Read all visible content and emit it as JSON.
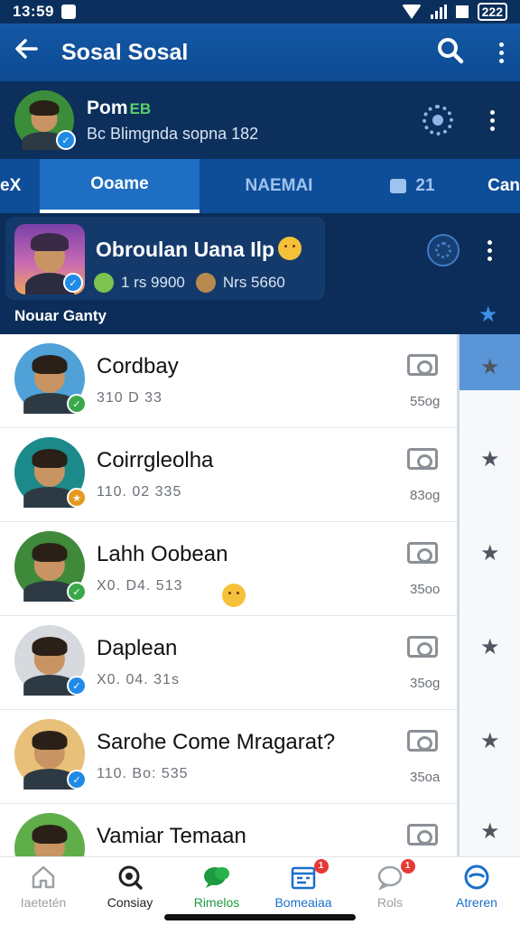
{
  "status_bar": {
    "time": "13:59",
    "battery": "222"
  },
  "app_bar": {
    "title": "Sosal Sosal",
    "back_icon": "arrow-left-icon",
    "search_icon": "search-icon",
    "menu_icon": "more-vert-icon"
  },
  "profile": {
    "name": "Pom",
    "name_tag": "EB",
    "subtitle": "Bc Blimgnda sopna 182",
    "badge_color": "#1f8be6"
  },
  "tabs": [
    {
      "label": "eX"
    },
    {
      "label": "Ooame"
    },
    {
      "label": "NAEMAI"
    },
    {
      "label": "21"
    },
    {
      "label": "Can"
    }
  ],
  "group": {
    "name": "Obroulan Uana Ilp",
    "stat1": "1 rs 9900",
    "stat2": "Nrs 5660",
    "owner": "Nouar Ganty"
  },
  "contacts": [
    {
      "name": "Cordbay",
      "meta": "310 D 33",
      "size": "55og",
      "badge_color": "#3aa84a",
      "bg": "#4fa1d8"
    },
    {
      "name": "Coirrgleolha",
      "meta": "110. 02 335",
      "size": "83og",
      "badge_color": "#e39a1e",
      "bg": "#1c8a8a"
    },
    {
      "name": "Lahh Oobean",
      "meta": "X0. D4. 513",
      "size": "35oo",
      "badge_color": "#3aa84a",
      "bg": "#3e8a3a"
    },
    {
      "name": "Daplean",
      "meta": "X0. 04. 31s",
      "size": "35og",
      "badge_color": "#1f8be6",
      "bg": "#d6d9dd"
    },
    {
      "name": "Sarohe Come Mragarat?",
      "meta": "110. Bo: 535",
      "size": "35oa",
      "badge_color": "#1f8be6",
      "bg": "#e9c07a"
    },
    {
      "name": "Vamiar Temaan",
      "meta": "",
      "size": "",
      "badge_color": "#3aa84a",
      "bg": "#5fae4a"
    }
  ],
  "bottom_nav": [
    {
      "label": "Iaetetén",
      "icon": "home-icon",
      "color": "#9aa0a6"
    },
    {
      "label": "Consiay",
      "icon": "search-icon",
      "color": "#222222"
    },
    {
      "label": "Rimelos",
      "icon": "chat-bubbles-icon",
      "color": "#1e9b3e"
    },
    {
      "label": "Bomeaiaa",
      "icon": "calendar-icon",
      "color": "#1a6fc9",
      "badge": "1"
    },
    {
      "label": "Rols",
      "icon": "chat-icon",
      "color": "#9aa0a6",
      "badge": "1"
    },
    {
      "label": "Atreren",
      "icon": "profile-icon",
      "color": "#1a6fc9"
    }
  ]
}
